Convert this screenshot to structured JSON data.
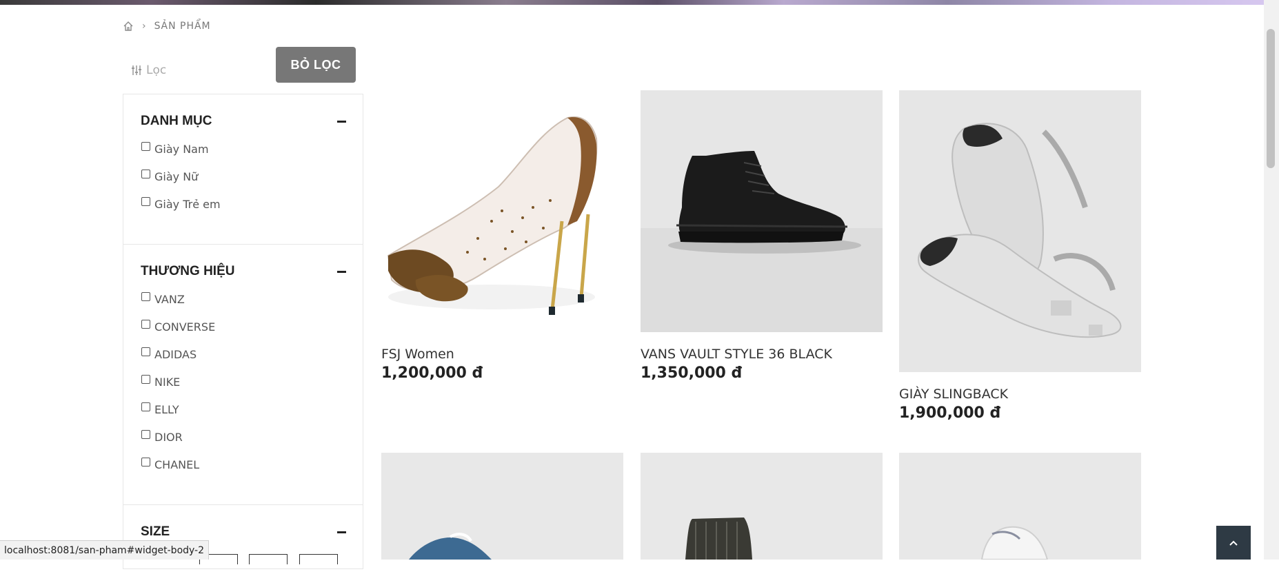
{
  "breadcrumb": {
    "home_icon": "home-icon",
    "current": "SẢN PHẨM"
  },
  "filter": {
    "label": "Lọc",
    "icon": "sliders-icon",
    "clear_button": "BỎ LỌC"
  },
  "sidebar": {
    "category": {
      "title": "DANH MỤC",
      "items": [
        "Giày Nam",
        "Giày Nữ",
        "Giày Trẻ em"
      ]
    },
    "brand": {
      "title": "THƯƠNG HIỆU",
      "items": [
        "VANZ",
        "CONVERSE",
        "ADIDAS",
        "NIKE",
        "ELLY",
        "DIOR",
        "CHANEL"
      ]
    },
    "size": {
      "title": "SIZE"
    }
  },
  "products": [
    {
      "name": "FSJ Women",
      "price": "1,200,000 đ",
      "image": "transparent-studded-pump"
    },
    {
      "name": "VANS VAULT STYLE 36 BLACK",
      "price": "1,350,000 đ",
      "image": "black-high-top-sneaker"
    },
    {
      "name": "GIÀY SLINGBACK",
      "price": "1,900,000 đ",
      "image": "silver-slingback-flats"
    }
  ],
  "status_bar": {
    "url": "localhost:8081/san-pham#widget-body-2"
  },
  "colors": {
    "button_gray": "#777777",
    "back_to_top": "#2e3a44",
    "image_bg": "#e8e8e8"
  }
}
